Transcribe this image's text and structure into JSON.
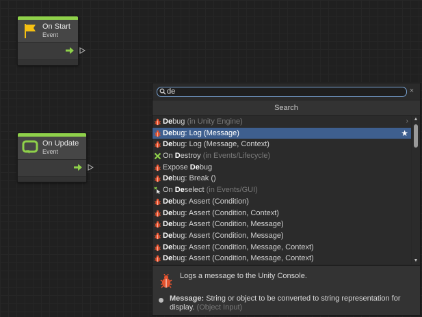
{
  "nodes": [
    {
      "title": "On Start",
      "subtitle": "Event"
    },
    {
      "title": "On Update",
      "subtitle": "Event"
    }
  ],
  "finder": {
    "search_value": "de",
    "header": "Search",
    "items": [
      {
        "match": "De",
        "rest": "bug",
        "hint": " (in Unity Engine)",
        "icon": "bug-icon"
      },
      {
        "match": "De",
        "rest": "bug: Log (Message)",
        "hint": "",
        "icon": "bug-icon"
      },
      {
        "match": "De",
        "rest": "bug: Log (Message, Context)",
        "hint": "",
        "icon": "bug-icon"
      },
      {
        "pre": "On ",
        "match": "D",
        "rest": "estroy",
        "hint": "  (in Events/Lifecycle)",
        "icon": "lifecycle-icon"
      },
      {
        "pre": "Expose ",
        "match": "De",
        "rest": "bug",
        "hint": "",
        "icon": "bug-icon"
      },
      {
        "match": "De",
        "rest": "bug: Break ()",
        "hint": "",
        "icon": "bug-icon"
      },
      {
        "pre": "On ",
        "match": "De",
        "rest": "select",
        "hint": "  (in Events/GUI)",
        "icon": "gui-event-icon"
      },
      {
        "match": "De",
        "rest": "bug: Assert (Condition)",
        "hint": "",
        "icon": "bug-icon"
      },
      {
        "match": "De",
        "rest": "bug: Assert (Condition, Context)",
        "hint": "",
        "icon": "bug-icon"
      },
      {
        "match": "De",
        "rest": "bug: Assert (Condition, Message)",
        "hint": "",
        "icon": "bug-icon"
      },
      {
        "match": "De",
        "rest": "bug: Assert (Condition, Message)",
        "hint": "",
        "icon": "bug-icon"
      },
      {
        "match": "De",
        "rest": "bug: Assert (Condition, Message, Context)",
        "hint": "",
        "icon": "bug-icon"
      },
      {
        "match": "De",
        "rest": "bug: Assert (Condition, Message, Context)",
        "hint": "",
        "icon": "bug-icon"
      }
    ],
    "detail": {
      "description": "Logs a message to the Unity Console.",
      "param_name": "Message:",
      "param_desc": " String or object to be converted to string representation for display.",
      "param_type": " (Object Input)"
    }
  },
  "colors": {
    "accent": "#8fd14a",
    "selection": "#3e5f8f",
    "focus": "#7aa5d6"
  }
}
